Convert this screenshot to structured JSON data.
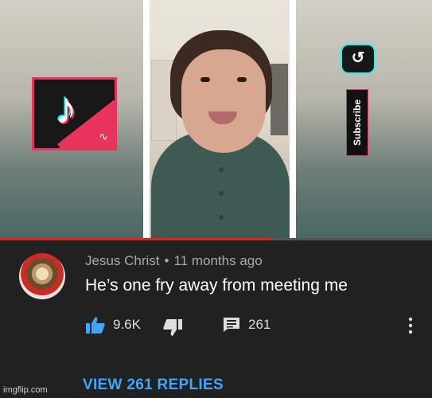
{
  "video": {
    "subscribe_label": "Subscribe",
    "progress_fraction": 0.63,
    "colors": {
      "progress": "#e62117",
      "tiktok_pink": "#e8345a",
      "tiktok_cyan": "#25f4ee"
    },
    "icons": [
      "tiktok-logo-icon",
      "subscribe-app-icon"
    ]
  },
  "comment": {
    "author": "Jesus Christ",
    "separator": "•",
    "time": "11 months ago",
    "text": "He’s one fry away from meeting me",
    "likes": "9.6K",
    "replies_count": "261",
    "view_replies_label": "VIEW 261 REPLIES",
    "colors": {
      "link": "#3ea6ff",
      "like_icon": "#3ea6ff"
    }
  },
  "watermark": "imgflip.com"
}
